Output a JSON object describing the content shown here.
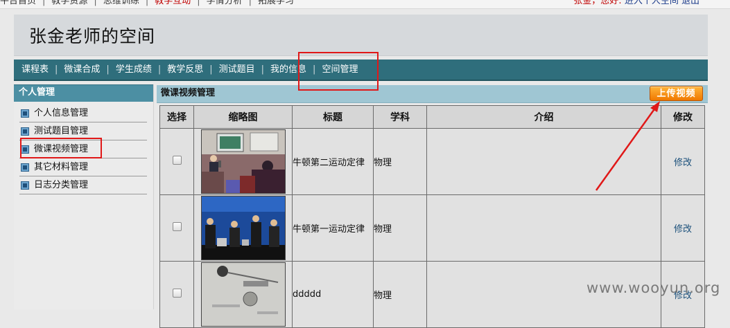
{
  "topnav": {
    "items": [
      {
        "label": "平台首页",
        "active": false
      },
      {
        "label": "教学资源",
        "active": false
      },
      {
        "label": "思维训练",
        "active": false
      },
      {
        "label": "教学互动",
        "active": true
      },
      {
        "label": "学情分析",
        "active": false
      },
      {
        "label": "拓展学习",
        "active": false
      }
    ],
    "greeting": "张金，您好:",
    "links": [
      "进入个人空间",
      "退出"
    ]
  },
  "header": {
    "title": "张金老师的空间"
  },
  "mainnav": {
    "items": [
      "课程表",
      "微课合成",
      "学生成绩",
      "教学反思",
      "测试题目",
      "我的信息",
      "空间管理"
    ]
  },
  "sidebar": {
    "title": "个人管理",
    "items": [
      "个人信息管理",
      "测试题目管理",
      "微课视频管理",
      "其它材料管理",
      "日志分类管理"
    ]
  },
  "content": {
    "title": "微课视频管理",
    "upload_label": "上传视频",
    "columns": [
      "选择",
      "缩略图",
      "标题",
      "学科",
      "介绍",
      "修改"
    ],
    "rows": [
      {
        "title": "牛顿第二运动定律",
        "subject": "物理",
        "intro": "",
        "edit": "修改"
      },
      {
        "title": "牛顿第一运动定律",
        "subject": "物理",
        "intro": "",
        "edit": "修改"
      },
      {
        "title": "ddddd",
        "subject": "物理",
        "intro": "",
        "edit": "修改"
      }
    ]
  },
  "watermark": "www.wooyun.org",
  "colors": {
    "nav_bg": "#2f6e7c",
    "sidebar_title_bg": "#4c8fa3",
    "content_head_bg": "#9fc6d3",
    "upload_button": "#f07800",
    "annotation_red": "#e01818"
  }
}
